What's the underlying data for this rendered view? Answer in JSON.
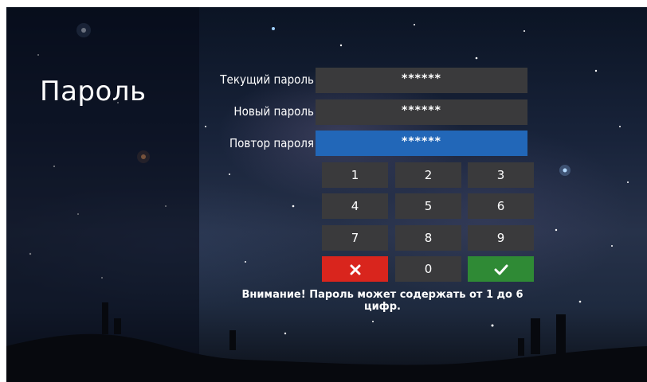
{
  "screen": {
    "title": "Пароль"
  },
  "fields": [
    {
      "label": "Текущий пароль",
      "value": "******",
      "active": false
    },
    {
      "label": "Новый пароль",
      "value": "******",
      "active": false
    },
    {
      "label": "Повтор пароля",
      "value": "******",
      "active": true
    }
  ],
  "keypad": {
    "digits": [
      "1",
      "2",
      "3",
      "4",
      "5",
      "6",
      "7",
      "8",
      "9",
      "0"
    ],
    "cancel_icon": "close-icon",
    "confirm_icon": "checkmark-icon"
  },
  "notice": "Внимание! Пароль может содержать от 1 до 6 цифр.",
  "colors": {
    "active_field": "#2267b8",
    "field": "#3a3a3c",
    "cancel": "#d9251d",
    "confirm": "#2f8a35"
  }
}
